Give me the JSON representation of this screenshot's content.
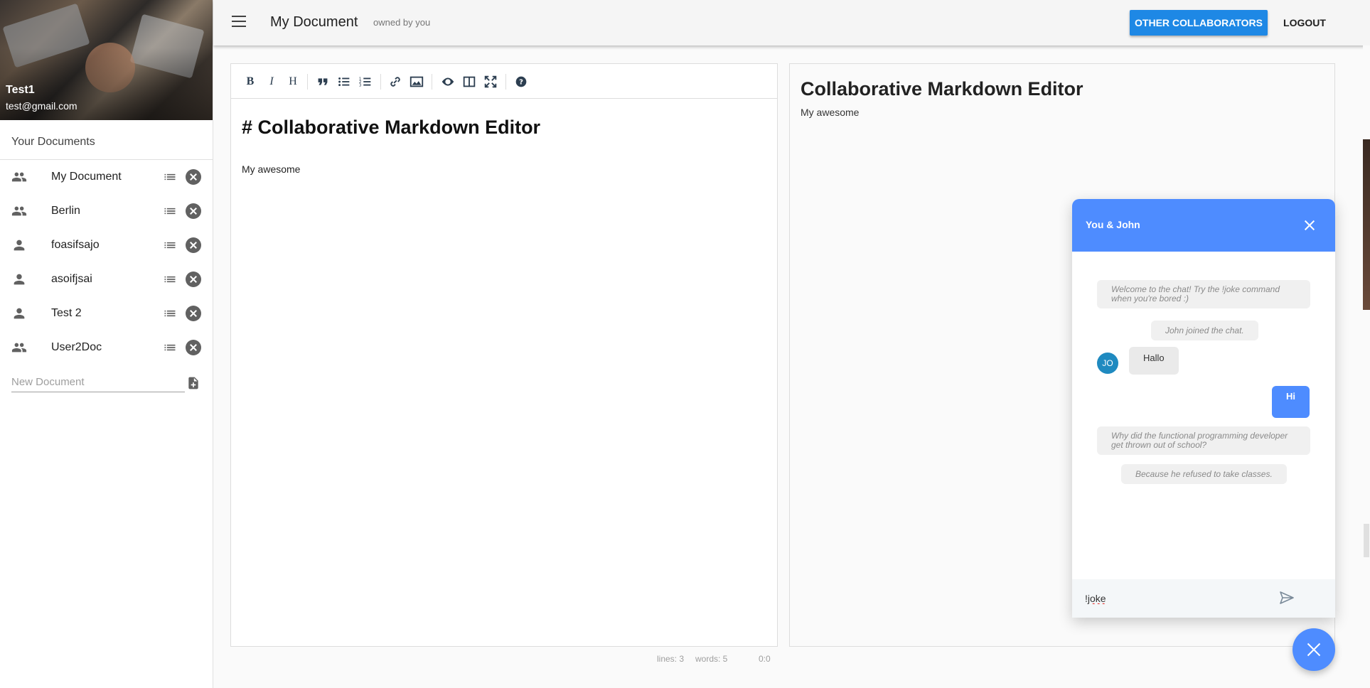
{
  "user": {
    "name": "Test1",
    "email": "test@gmail.com"
  },
  "sidebar": {
    "title": "Your Documents",
    "documents": [
      {
        "label": "My Document",
        "shared": true
      },
      {
        "label": "Berlin",
        "shared": true
      },
      {
        "label": "foasifsajo",
        "shared": false
      },
      {
        "label": "asoifjsai",
        "shared": false
      },
      {
        "label": "Test 2",
        "shared": false
      },
      {
        "label": "User2Doc",
        "shared": true
      }
    ],
    "new_document_placeholder": "New Document"
  },
  "header": {
    "title": "My Document",
    "owner": "owned by you",
    "collaborators_label": "OTHER COLLABORATORS",
    "logout_label": "LOGOUT"
  },
  "editor": {
    "heading": "# Collaborative Markdown Editor",
    "body": "My awesome",
    "status": {
      "lines": "lines: 3",
      "words": "words: 5",
      "cursor": "0:0"
    }
  },
  "preview": {
    "heading": "Collaborative Markdown Editor",
    "body": "My awesome"
  },
  "chat": {
    "title": "You & John",
    "messages": {
      "welcome": "Welcome to the chat! Try the !joke command when you're bored :)",
      "joined": "John joined the chat.",
      "avatar": "JO",
      "incoming": "Hallo",
      "outgoing": "Hi",
      "joke_q": "Why did the functional programming developer get thrown out of school?",
      "joke_a": "Because he refused to take classes."
    },
    "input_value": "!joke"
  },
  "colors": {
    "primary": "#1e88e5",
    "chat_accent": "#4e8cff",
    "avatar": "#1f8ac0"
  }
}
